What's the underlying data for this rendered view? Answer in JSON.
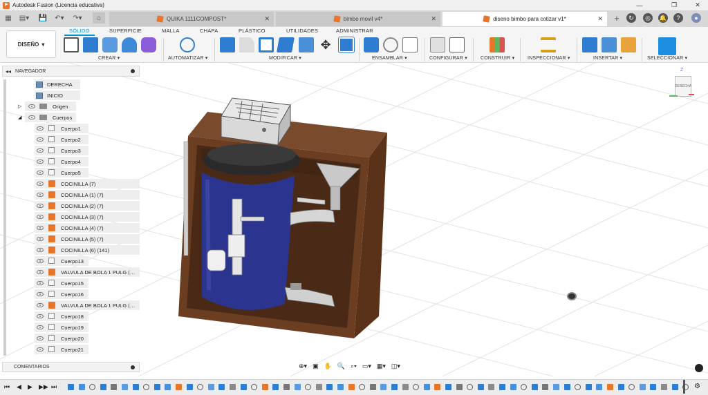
{
  "window": {
    "title": "Autodesk Fusion (Licencia educativa)",
    "controls": {
      "minimize": "—",
      "maximize": "❐",
      "close": "✕"
    }
  },
  "tabs": [
    {
      "label": "QUIKA 1111COMPOST*",
      "active": false
    },
    {
      "label": "bimbo movil v4*",
      "active": false
    },
    {
      "label": "diseno bimbo para cotizar v1*",
      "active": true
    }
  ],
  "toolbar_right": {
    "new_tab": "+"
  },
  "ribbon": {
    "workspace": "DISEÑO",
    "tabs": [
      "SÓLIDO",
      "SUPERFICIE",
      "MALLA",
      "CHAPA",
      "PLÁSTICO",
      "UTILIDADES",
      "ADMINISTRAR"
    ],
    "active_tab": "SÓLIDO",
    "groups": [
      "CREAR",
      "AUTOMATIZAR",
      "MODIFICAR",
      "ENSAMBLAR",
      "CONFIGURAR",
      "CONSTRUIR",
      "INSPECCIONAR",
      "INSERTAR",
      "SELECCIONAR"
    ]
  },
  "browser": {
    "title": "NAVEGADOR",
    "items": [
      {
        "label": "DERECHA",
        "type": "view",
        "level": 2
      },
      {
        "label": "INICIO",
        "type": "view",
        "level": 2
      },
      {
        "label": "Origen",
        "type": "folder",
        "level": 1,
        "expand": "▷"
      },
      {
        "label": "Cuerpos",
        "type": "folder",
        "level": 1,
        "expand": "◢"
      },
      {
        "label": "Cuerpo1",
        "type": "body",
        "level": 3
      },
      {
        "label": "Cuerpo2",
        "type": "body",
        "level": 3
      },
      {
        "label": "Cuerpo3",
        "type": "body",
        "level": 3
      },
      {
        "label": "Cuerpo4",
        "type": "body",
        "level": 3
      },
      {
        "label": "Cuerpo5",
        "type": "body",
        "level": 3
      },
      {
        "label": "COCINILLA (7)",
        "type": "component",
        "level": 3
      },
      {
        "label": "COCINILLA (1) (7)",
        "type": "component",
        "level": 3
      },
      {
        "label": "COCINILLA (2) (7)",
        "type": "component",
        "level": 3
      },
      {
        "label": "COCINILLA (3) (7)",
        "type": "component",
        "level": 3
      },
      {
        "label": "COCINILLA (4) (7)",
        "type": "component",
        "level": 3
      },
      {
        "label": "COCINILLA (5) (7)",
        "type": "component",
        "level": 3
      },
      {
        "label": "COCINILLA (6) (141)",
        "type": "component",
        "level": 3
      },
      {
        "label": "Cuerpo13",
        "type": "body",
        "level": 3
      },
      {
        "label": "VALVULA DE BOLA 1 PULG (…",
        "type": "component",
        "level": 3
      },
      {
        "label": "Cuerpo15",
        "type": "body",
        "level": 3
      },
      {
        "label": "Cuerpo16",
        "type": "body",
        "level": 3
      },
      {
        "label": "VALVULA DE BOLA 1 PULG (…",
        "type": "component",
        "level": 3
      },
      {
        "label": "Cuerpo18",
        "type": "body",
        "level": 3
      },
      {
        "label": "Cuerpo19",
        "type": "body",
        "level": 3
      },
      {
        "label": "Cuerpo20",
        "type": "body",
        "level": 3
      },
      {
        "label": "Cuerpo21",
        "type": "body",
        "level": 3
      }
    ]
  },
  "comments": {
    "title": "COMENTARIOS"
  },
  "viewcube": {
    "face": "DERECHA",
    "axis_z": "Z"
  },
  "colors": {
    "accent": "#0696d7",
    "wood": "#6b3e22",
    "tank": "#2b3590",
    "brand": "#e8762a"
  }
}
